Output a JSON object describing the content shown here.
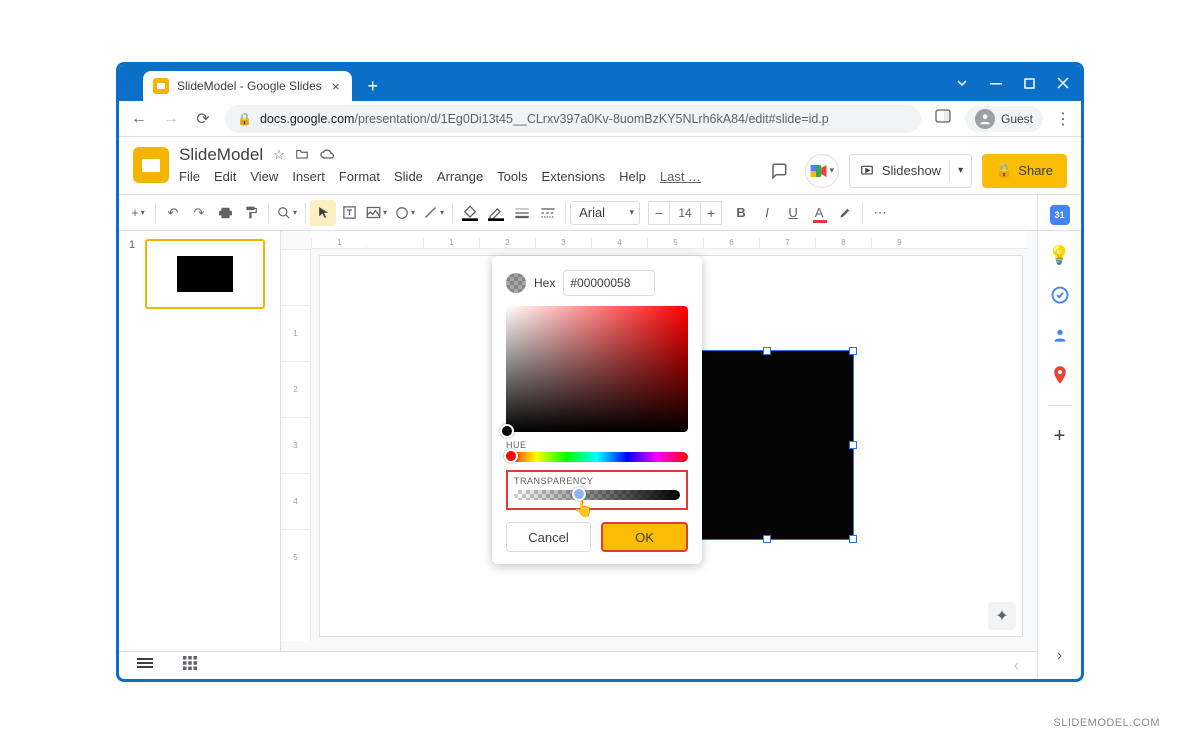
{
  "window": {
    "tab_title": "SlideModel - Google Slides",
    "url_domain": "docs.google.com",
    "url_path": "/presentation/d/1Eg0Di13t45__CLrxv397a0Kv-8uomBzKY5NLrh6kA84/edit#slide=id.p",
    "guest_label": "Guest"
  },
  "doc": {
    "name": "SlideModel",
    "menus": [
      "File",
      "Edit",
      "View",
      "Insert",
      "Format",
      "Slide",
      "Arrange",
      "Tools",
      "Extensions",
      "Help"
    ],
    "last_label": "Last …",
    "slideshow_label": "Slideshow",
    "share_label": "Share"
  },
  "toolbar": {
    "font": "Arial",
    "font_size": "14"
  },
  "ruler": {
    "h": [
      "1",
      "",
      "1",
      "2",
      "3",
      "4",
      "5",
      "6",
      "7",
      "8",
      "9"
    ],
    "v": [
      "",
      "1",
      "2",
      "3",
      "4",
      "5"
    ]
  },
  "thumbs": {
    "num1": "1"
  },
  "colorpicker": {
    "hex_label": "Hex",
    "hex_value": "#00000058",
    "hue_label": "HUE",
    "transparency_label": "TRANSPARENCY",
    "cancel": "Cancel",
    "ok": "OK"
  },
  "watermark": "SLIDEMODEL.COM",
  "colors": {
    "accent": "#0b6fc7",
    "brand_yellow": "#fbbc04",
    "highlight_red": "#e53935"
  }
}
